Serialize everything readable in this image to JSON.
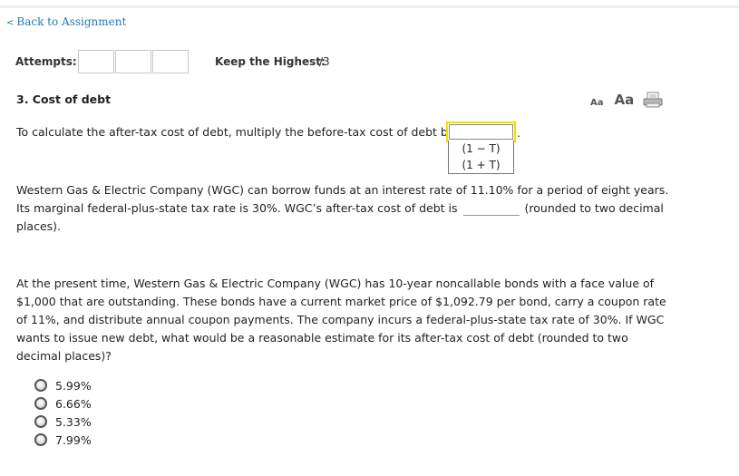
{
  "nav": {
    "back_chevron": "<",
    "back_label": "Back to Assignment"
  },
  "attempts": {
    "label": "Attempts:",
    "keep_label": "Keep the Highest:",
    "keep_value": "/3"
  },
  "question": {
    "title": "3. Cost of debt",
    "font_small_label": "Aa",
    "font_large_label": "Aa",
    "print_icon": "printer-icon"
  },
  "part1": {
    "text": "To calculate the after-tax cost of debt, multiply the before-tax cost of debt by",
    "dropdown_value": "",
    "dropdown_options": [
      "(1 − T)",
      "(1 + T)"
    ],
    "end_punct": "."
  },
  "part2": {
    "text_before": "Western Gas & Electric Company (WGC) can borrow funds at an interest rate of 11.10% for a period of eight years. Its marginal federal-plus-state tax rate is 30%. WGC’s after-tax cost of debt is",
    "answer_value": "",
    "text_after": "(rounded to two decimal places)."
  },
  "part3": {
    "text": "At the present time, Western Gas & Electric Company (WGC) has 10-year noncallable bonds with a face value of $1,000 that are outstanding. These bonds have a current market price of $1,092.79 per bond, carry a coupon rate of 11%, and distribute annual coupon payments. The company incurs a federal-plus-state tax rate of 30%. If WGC wants to issue new debt, what would be a reasonable estimate for its after-tax cost of debt (rounded to two decimal places)?",
    "options": [
      "5.99%",
      "6.66%",
      "5.33%",
      "7.99%"
    ]
  },
  "colors": {
    "link": "#2577b5",
    "dropdown_highlight": "#f0e000",
    "text": "#222222"
  }
}
